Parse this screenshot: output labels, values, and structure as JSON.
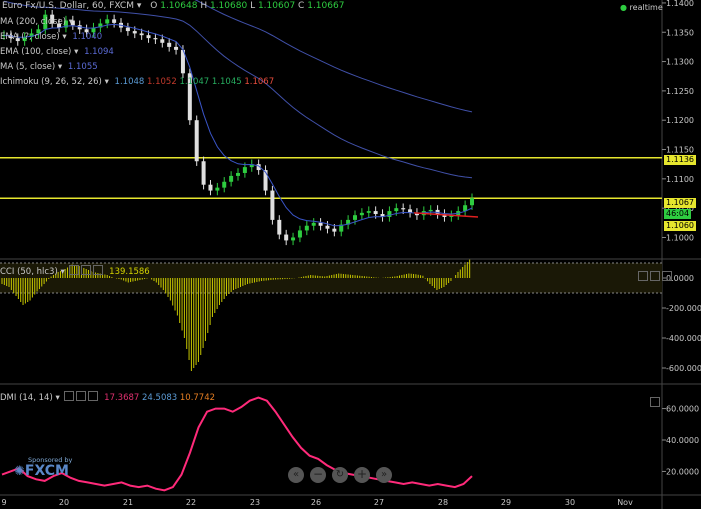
{
  "header": {
    "symbol": "Euro Fx/U.S. Dollar, 60, FXCM",
    "o_label": "O",
    "o": "1.10648",
    "h_label": "H",
    "h": "1.10680",
    "l_label": "L",
    "l": "1.10607",
    "c_label": "C",
    "c": "1.10667",
    "realtime": "realtime"
  },
  "indicators": [
    {
      "label": "MA (200, close)",
      "value": "",
      "color": "#c8c8c8"
    },
    {
      "label": "EMA (?, close)",
      "value": "1.1040",
      "color": "#5b6bd6"
    },
    {
      "label": "EMA (100, close)",
      "value": "1.1094",
      "color": "#5b6bd6"
    },
    {
      "label": "MA (5, close)",
      "value": "1.1055",
      "color": "#5b6bd6"
    },
    {
      "label": "Ichimoku (9, 26, 52, 26)",
      "value": "",
      "color": "#c8c8c8"
    }
  ],
  "ichimoku_values": [
    {
      "value": "1.1048",
      "color": "#5b9bd5"
    },
    {
      "value": "1.1052",
      "color": "#c0392b"
    },
    {
      "value": "1.1047",
      "color": "#27ae60"
    },
    {
      "value": "1.1045",
      "color": "#27ae60"
    },
    {
      "value": "1.1067",
      "color": "#e74c3c"
    }
  ],
  "price_tags": {
    "level_upper": "1.1136",
    "last": "1.1067",
    "countdown": "46:04",
    "level_lower": "1.1060"
  },
  "cci": {
    "label": "CCI (50, hlc3)",
    "value": "139.1586",
    "color": "#d4d400"
  },
  "dmi": {
    "label": "DMI (14, 14)",
    "v1": "17.3687",
    "v1_color": "#e0306f",
    "v2": "24.5083",
    "v2_color": "#5b9bd5",
    "v3": "10.7742",
    "v3_color": "#e67e22"
  },
  "sponsor": {
    "line1": "Sponsored by",
    "brand": "FXCM"
  },
  "colors": {
    "up": "#2ecc40",
    "down": "#e0e0e0",
    "level": "#e6e62e",
    "ema": "#4050a8",
    "dmi": "#ff2a7a",
    "cci": "#c8c800"
  },
  "chart_data": [
    {
      "type": "candlestick",
      "title": "Euro Fx/U.S. Dollar, 60, FXCM",
      "ylim": [
        1.0965,
        1.1405
      ],
      "yticks": [
        "1.1400",
        "1.1350",
        "1.1300",
        "1.1250",
        "1.1200",
        "1.1150",
        "1.1100",
        "1.1050",
        "1.1000"
      ],
      "ytick_values": [
        1.14,
        1.135,
        1.13,
        1.125,
        1.12,
        1.115,
        1.11,
        1.105,
        1.1
      ],
      "horizontal_levels": [
        1.1136,
        1.1067
      ],
      "x_labels": [
        "9",
        "20",
        "21",
        "22",
        "23",
        "26",
        "27",
        "28",
        "29",
        "30",
        "Nov"
      ],
      "close_path": [
        1.1345,
        1.134,
        1.1335,
        1.1342,
        1.1348,
        1.1355,
        1.138,
        1.1365,
        1.1358,
        1.137,
        1.1362,
        1.1355,
        1.135,
        1.1358,
        1.1365,
        1.1372,
        1.1366,
        1.1358,
        1.1352,
        1.1348,
        1.1345,
        1.134,
        1.1338,
        1.1332,
        1.1325,
        1.132,
        1.128,
        1.12,
        1.113,
        1.109,
        1.108,
        1.1085,
        1.1095,
        1.1105,
        1.111,
        1.112,
        1.1125,
        1.1115,
        1.108,
        1.103,
        1.1005,
        1.0995,
        1.1,
        1.1012,
        1.102,
        1.1025,
        1.102,
        1.1015,
        1.101,
        1.1022,
        1.103,
        1.1038,
        1.1042,
        1.1045,
        1.104,
        1.1035,
        1.1045,
        1.105,
        1.1048,
        1.1042,
        1.1038,
        1.1045,
        1.1047,
        1.104,
        1.1035,
        1.1038,
        1.1045,
        1.1055,
        1.1067
      ]
    },
    {
      "type": "bar",
      "title": "CCI (50, hlc3)",
      "ylim": [
        -700,
        120
      ],
      "yticks": [
        "0.0000",
        "-200.0000",
        "-400.0000",
        "-600.0000"
      ],
      "ytick_values": [
        0,
        -200,
        -400,
        -600
      ],
      "reference_lines": [
        100,
        -100
      ],
      "values_path": [
        -40,
        -60,
        -120,
        -180,
        -150,
        -90,
        -40,
        10,
        40,
        60,
        90,
        80,
        60,
        40,
        30,
        20,
        0,
        -10,
        -30,
        -20,
        -10,
        0,
        -30,
        -80,
        -150,
        -250,
        -400,
        -620,
        -560,
        -420,
        -260,
        -180,
        -120,
        -80,
        -60,
        -40,
        -30,
        -20,
        -15,
        -10,
        -8,
        -5,
        0,
        10,
        20,
        15,
        10,
        20,
        30,
        25,
        20,
        15,
        10,
        5,
        0,
        5,
        10,
        20,
        30,
        25,
        15,
        -40,
        -80,
        -60,
        -20,
        40,
        90,
        139
      ]
    },
    {
      "type": "line",
      "title": "DMI (14, 14)",
      "ylim": [
        5,
        75
      ],
      "yticks": [
        "60.0000",
        "40.0000",
        "20.0000"
      ],
      "ytick_values": [
        60,
        40,
        20
      ],
      "values": [
        18,
        20,
        22,
        17,
        15,
        14,
        17,
        19,
        16,
        14,
        13,
        12,
        11,
        12,
        13,
        11,
        10,
        11,
        9,
        8,
        10,
        18,
        32,
        48,
        58,
        60,
        60,
        58,
        61,
        65,
        67,
        65,
        58,
        50,
        42,
        35,
        30,
        28,
        24,
        21,
        19,
        18,
        17,
        16,
        15,
        14,
        13,
        12,
        13,
        12,
        11,
        12,
        11,
        10,
        12,
        17
      ]
    }
  ]
}
